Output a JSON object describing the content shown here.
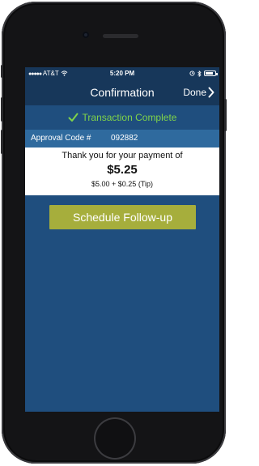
{
  "status_bar": {
    "signal_dots": "●●●●●",
    "carrier": "AT&T",
    "time": "5:20 PM",
    "battery_level": 0.8
  },
  "nav": {
    "title": "Confirmation",
    "done_label": "Done"
  },
  "banner": {
    "text": "Transaction Complete",
    "color": "#7fd34a"
  },
  "approval": {
    "label": "Approval Code #",
    "code": "092882"
  },
  "payment": {
    "message": "Thank you for your payment of",
    "amount": "$5.25",
    "breakdown": "$5.00 + $0.25 (Tip)"
  },
  "actions": {
    "schedule_label": "Schedule Follow-up",
    "schedule_color": "#a6ae3c"
  },
  "icons": [
    "wifi-icon",
    "alarm-icon",
    "bluetooth-icon",
    "battery-icon",
    "chevron-right-icon",
    "checkmark-icon"
  ]
}
